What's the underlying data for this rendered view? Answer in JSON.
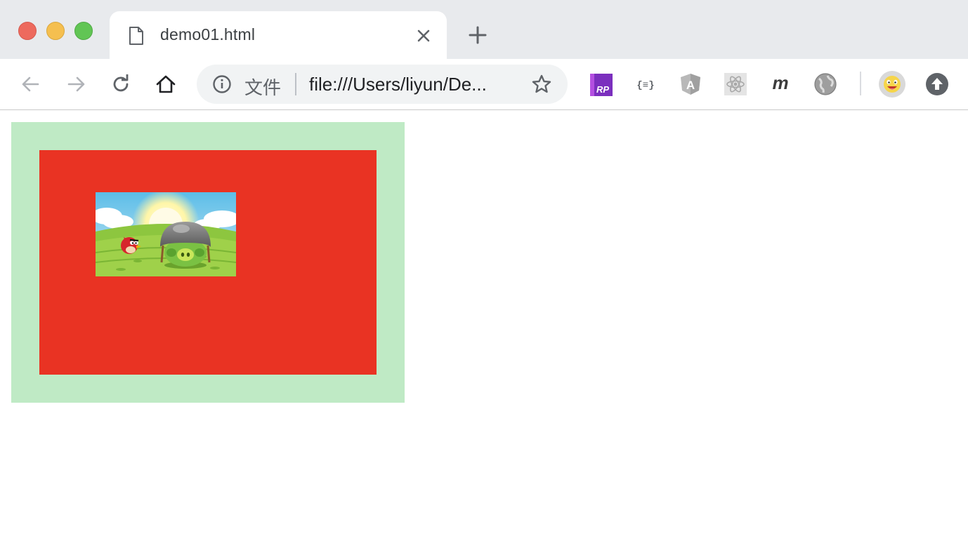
{
  "window": {
    "traffic_lights": {
      "close_color": "#ed6a5e",
      "minimize_color": "#f5bf4f",
      "maximize_color": "#61c554"
    }
  },
  "tab": {
    "title": "demo01.html",
    "icon": "document-icon"
  },
  "toolbar": {
    "back_icon": "arrow-left-icon",
    "forward_icon": "arrow-right-icon",
    "reload_icon": "reload-icon",
    "home_icon": "home-icon"
  },
  "omnibox": {
    "scheme_label": "文件",
    "url": "file:///Users/liyun/De...",
    "info_icon": "info-icon",
    "bookmark_icon": "star-icon"
  },
  "extensions": [
    {
      "name": "axure-rp-extension",
      "label": "RP"
    },
    {
      "name": "json-formatter-extension",
      "label": "{≡}"
    },
    {
      "name": "angular-devtools-extension",
      "label": "A"
    },
    {
      "name": "react-devtools-extension",
      "label": ""
    },
    {
      "name": "m-extension",
      "label": "m"
    },
    {
      "name": "globe-extension",
      "label": ""
    }
  ],
  "profile": {
    "icon": "emoji-avatar-icon"
  },
  "update": {
    "icon": "upload-arrow-icon"
  },
  "content": {
    "outer_box_color": "#bfeac5",
    "inner_box_color": "#e93323",
    "image": "angry-birds-pig-with-helmet-image"
  }
}
